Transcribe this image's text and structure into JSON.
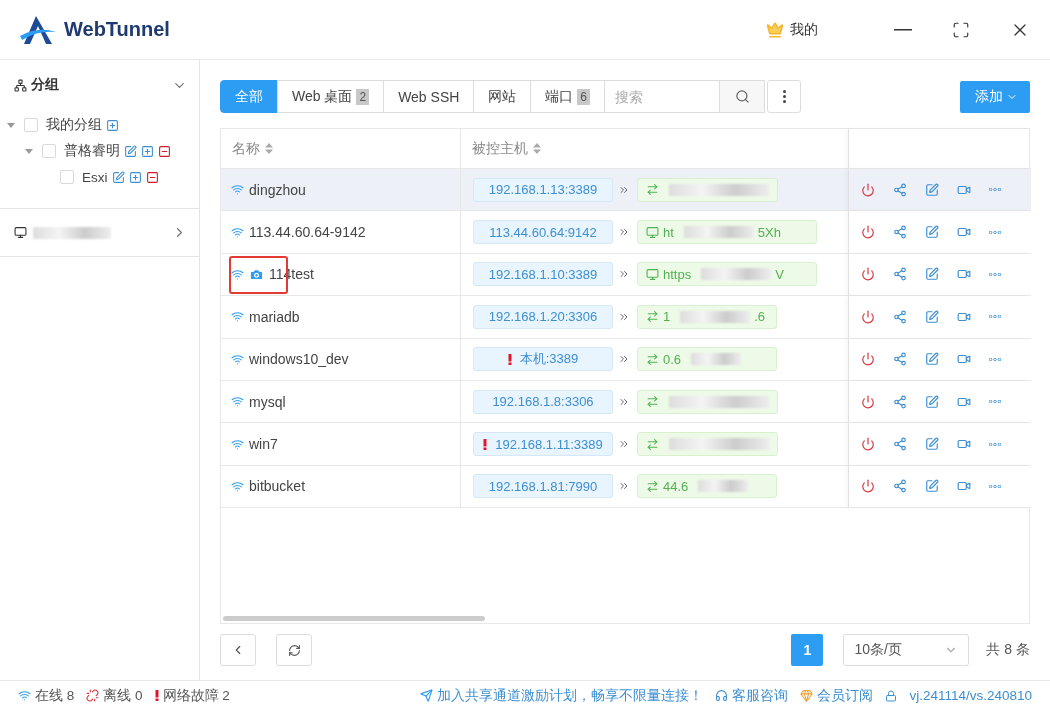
{
  "app": {
    "title": "WebTunnel"
  },
  "header": {
    "user_label": "我的"
  },
  "sidebar": {
    "group_title": "分组",
    "group_expanded": true,
    "tree": [
      {
        "label": "我的分组",
        "checked": false,
        "expanded": true,
        "children": [
          {
            "label": "普格睿明",
            "checked": false,
            "expanded": true,
            "children": [
              {
                "label": "Esxi",
                "checked": false
              }
            ]
          }
        ]
      }
    ],
    "second_section_expanded": false
  },
  "tabs": [
    {
      "label": "全部",
      "selected": true
    },
    {
      "label": "Web 桌面",
      "count": "2",
      "selected": false
    },
    {
      "label": "Web SSH",
      "selected": false
    },
    {
      "label": "网站",
      "selected": false
    },
    {
      "label": "端口",
      "count": "6",
      "selected": false
    }
  ],
  "search": {
    "placeholder": "搜索"
  },
  "add_button": {
    "label": "添加"
  },
  "table": {
    "columns": [
      "名称",
      "被控主机"
    ],
    "rows": [
      {
        "name": "dingzhou",
        "camera": false,
        "highlighted": false,
        "selected": true,
        "source": "192.168.1.13:3389",
        "warning": false,
        "target": {
          "kind": "tunnel"
        }
      },
      {
        "name": "113.44.60.64-9142",
        "camera": false,
        "highlighted": false,
        "selected": false,
        "source": "113.44.60.64:9142",
        "warning": false,
        "target": {
          "kind": "web",
          "parts": [
            "ht",
            "5Xh"
          ]
        }
      },
      {
        "name": "114test",
        "camera": true,
        "highlighted": true,
        "selected": false,
        "source": "192.168.1.10:3389",
        "warning": false,
        "target": {
          "kind": "web",
          "parts": [
            "https",
            "V"
          ]
        }
      },
      {
        "name": "mariadb",
        "camera": false,
        "highlighted": false,
        "selected": false,
        "source": "192.168.1.20:3306",
        "warning": false,
        "target": {
          "kind": "tunnel",
          "parts": [
            "1",
            ".6"
          ]
        }
      },
      {
        "name": "windows10_dev",
        "camera": false,
        "highlighted": false,
        "selected": false,
        "source": "本机:3389",
        "warning": true,
        "target": {
          "kind": "tunnel",
          "parts": [
            "0.6"
          ]
        }
      },
      {
        "name": "mysql",
        "camera": false,
        "highlighted": false,
        "selected": false,
        "source": "192.168.1.8:3306",
        "warning": false,
        "target": {
          "kind": "tunnel"
        }
      },
      {
        "name": "win7",
        "camera": false,
        "highlighted": false,
        "selected": false,
        "source": "192.168.1.11:3389",
        "warning": true,
        "target": {
          "kind": "tunnel"
        }
      },
      {
        "name": "bitbucket",
        "camera": false,
        "highlighted": false,
        "selected": false,
        "source": "192.168.1.81:7990",
        "warning": false,
        "target": {
          "kind": "tunnel",
          "parts": [
            "44.6"
          ]
        }
      }
    ]
  },
  "pagination": {
    "pages": [
      {
        "label": "1",
        "selected": true
      }
    ],
    "page_size": "10条/页",
    "total": "共 8 条"
  },
  "status_bar": {
    "online": "在线 8",
    "offline": "离线 0",
    "fault": "网络故障 2",
    "promo": "加入共享通道激励计划，畅享不限量连接！",
    "support": "客服咨询",
    "membership": "会员订阅",
    "version": "vj.241114/vs.240810"
  }
}
